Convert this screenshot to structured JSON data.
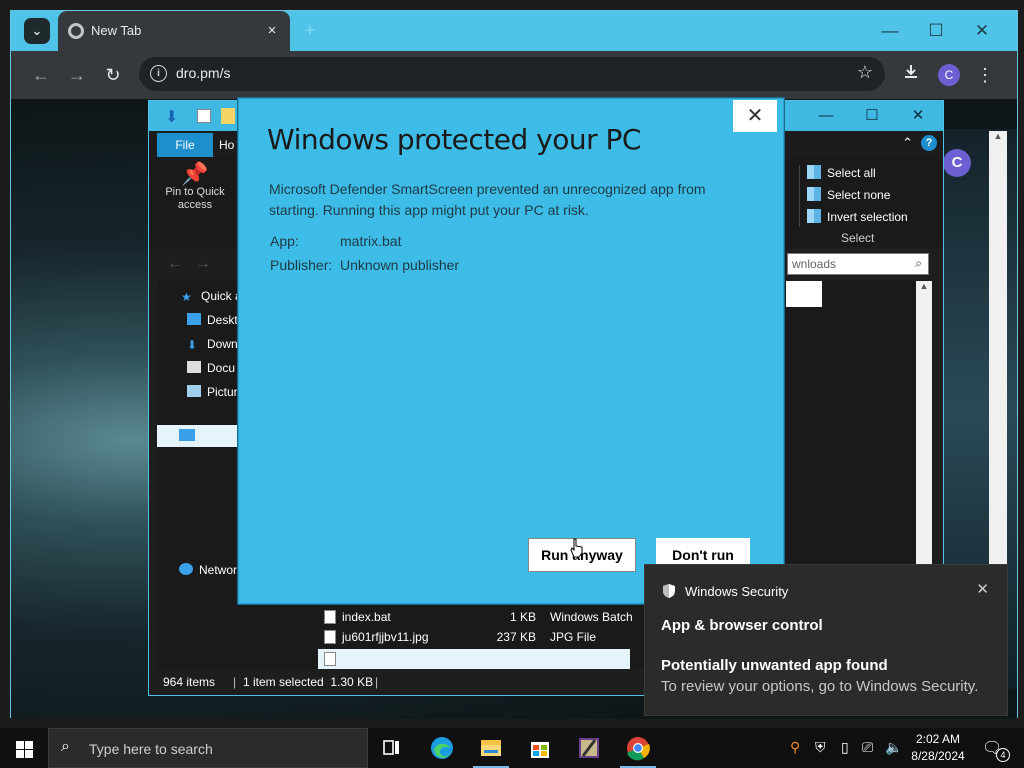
{
  "browser": {
    "tab_title": "New Tab",
    "tab_close": "×",
    "new_tab": "+",
    "url": "dro.pm/s",
    "profile_initial": "C",
    "window_controls": {
      "minimize": "—",
      "maximize": "☐",
      "close": "✕"
    }
  },
  "page": {
    "avatar_initial": "C"
  },
  "explorer": {
    "ribbon_tabs": {
      "file": "File",
      "home": "Ho"
    },
    "pin_label": "Pin to Quick access",
    "select_group": {
      "items": [
        "Select all",
        "Select none",
        "Invert selection"
      ],
      "label": "Select"
    },
    "search_placeholder": "wnloads",
    "nav_items": [
      "Quick a",
      "Deskt",
      "Down",
      "Docu",
      "Pictur",
      "",
      "Networ"
    ],
    "files": [
      {
        "name": "index.bat",
        "size": "1 KB",
        "type": "Windows Batch"
      },
      {
        "name": "ju601rfjjbv11.jpg",
        "size": "237 KB",
        "type": "JPG File"
      }
    ],
    "status": {
      "count": "964 items",
      "selected": "1 item selected  1.30 KB"
    }
  },
  "smartscreen": {
    "title": "Windows protected your PC",
    "description": "Microsoft Defender SmartScreen prevented an unrecognized app from starting. Running this app might put your PC at risk.",
    "app_label": "App:",
    "app_value": "matrix.bat",
    "publisher_label": "Publisher:",
    "publisher_value": "Unknown publisher",
    "run_anyway": "Run anyway",
    "dont_run": "Don't run",
    "close": "✕"
  },
  "toast": {
    "app_name": "Windows Security",
    "heading": "App & browser control",
    "subheading": "Potentially unwanted app found",
    "body": "To review your options, go to Windows Security."
  },
  "taskbar": {
    "search_placeholder": "Type here to search",
    "time": "2:02 AM",
    "date": "8/28/2024",
    "notification_count": "4",
    "apps": [
      "task-view",
      "edge",
      "file-explorer",
      "microsoft-store",
      "winrar",
      "chrome"
    ]
  },
  "colors": {
    "accent": "#4fc4e8",
    "dialog": "#3cbce6",
    "toast_bg": "#2b2b2b",
    "taskbar": "#101010"
  }
}
